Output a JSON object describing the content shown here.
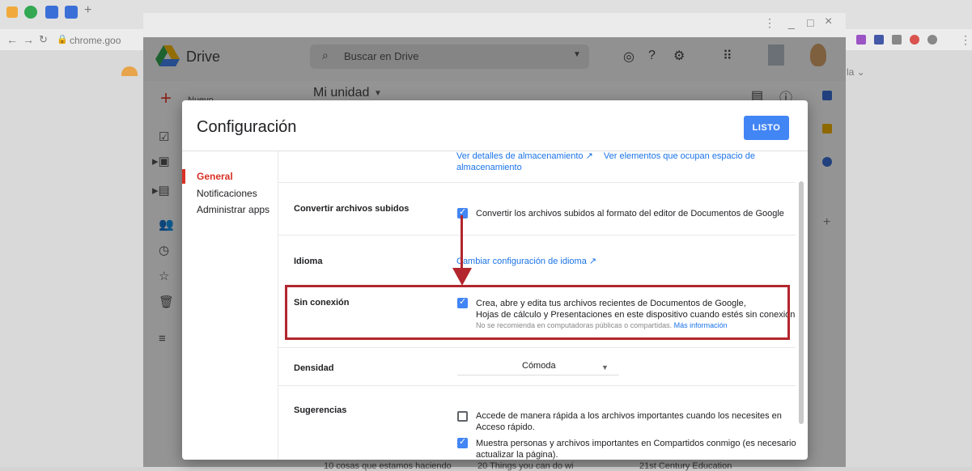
{
  "outer": {
    "address": "chrome.goo",
    "right_fragment": "la ⌄",
    "tab_plus": "+"
  },
  "inner_window": {
    "controls": {
      "minimize": "_",
      "maximize": "□",
      "close": "×",
      "menu": "⋮"
    }
  },
  "drive": {
    "app_name": "Drive",
    "search_placeholder": "Buscar en Drive",
    "new_button": "Nuevo",
    "breadcrumb": "Mi unidad",
    "bottom_files": [
      "10 cosas que estamos haciendo",
      "20 Things you can do wi",
      "21st Century Education"
    ]
  },
  "settings": {
    "title": "Configuración",
    "done_button": "LISTO",
    "nav": [
      "General",
      "Notificaciones",
      "Administrar apps"
    ],
    "storage_link_1": "Ver detalles de almacenamiento",
    "storage_link_2": "Ver elementos que ocupan espacio de almacenamiento",
    "convert": {
      "label": "Convertir archivos subidos",
      "option": "Convertir los archivos subidos al formato del editor de Documentos de Google",
      "checked": true
    },
    "language": {
      "label": "Idioma",
      "link": "Cambiar configuración de idioma"
    },
    "offline": {
      "label": "Sin conexión",
      "text_line1": "Crea, abre y edita tus archivos recientes de Documentos de Google,",
      "text_line2": "Hojas de cálculo y Presentaciones en este dispositivo cuando estés sin conexión",
      "note": "No se recomienda en computadoras públicas o compartidas.",
      "more_link": "Más información",
      "checked": true
    },
    "density": {
      "label": "Densidad",
      "value": "Cómoda"
    },
    "suggestions": {
      "label": "Sugerencias",
      "option1_line1": "Accede de manera rápida a los archivos importantes cuando los necesites en",
      "option1_line2": "Acceso rápido.",
      "option1_checked": false,
      "option2_line1": "Muestra personas y archivos importantes en Compartidos conmigo (es necesario",
      "option2_line2": "actualizar la página).",
      "option2_checked": true
    }
  },
  "colors": {
    "accent_blue": "#4285f4",
    "link_blue": "#1a73e8",
    "annotation_red": "#b3262d",
    "nav_active_red": "#d93025"
  }
}
